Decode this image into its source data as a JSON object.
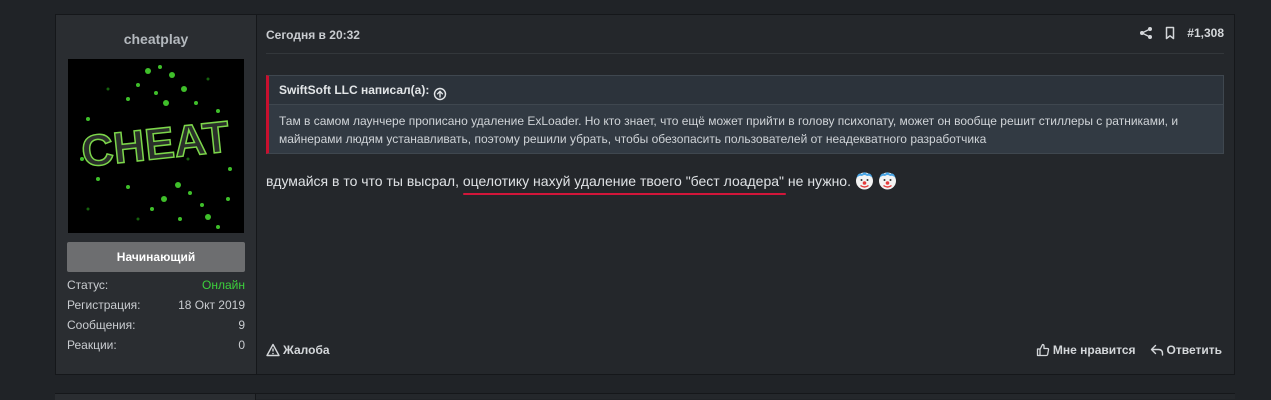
{
  "user": {
    "username": "cheatplay",
    "avatar_text": "CHEAT",
    "rank": "Начинающий",
    "stats": [
      {
        "label": "Статус:",
        "value": "Онлайн"
      },
      {
        "label": "Регистрация:",
        "value": "18 Окт 2019"
      },
      {
        "label": "Сообщения:",
        "value": "9"
      },
      {
        "label": "Реакции:",
        "value": "0"
      }
    ]
  },
  "post": {
    "date": "Сегодня в 20:32",
    "number": "#1,308",
    "quote": {
      "author": "SwiftSoft LLC написал(а):",
      "text": "Там в самом лаунчере прописано удаление ExLoader. Но кто знает, что ещё может прийти в голову психопату, может он вообще решит стиллеры с ратниками, и майнерами людям устанавливать, поэтому решили убрать, чтобы обезопасить пользователей от неадекватного разработчика"
    },
    "message": {
      "before": "вдумайся в то что ты высрал, ",
      "underlined": "оцелотику нахуй удаление твоего \"бест лоадера\"",
      "after": " не нужно."
    }
  },
  "footer": {
    "report": "Жалоба",
    "like": "Мне нравится",
    "reply": "Ответить"
  },
  "colors": {
    "online": "#3ccf3c",
    "quote_accent": "#c8102e",
    "underline": "#d2163a"
  }
}
